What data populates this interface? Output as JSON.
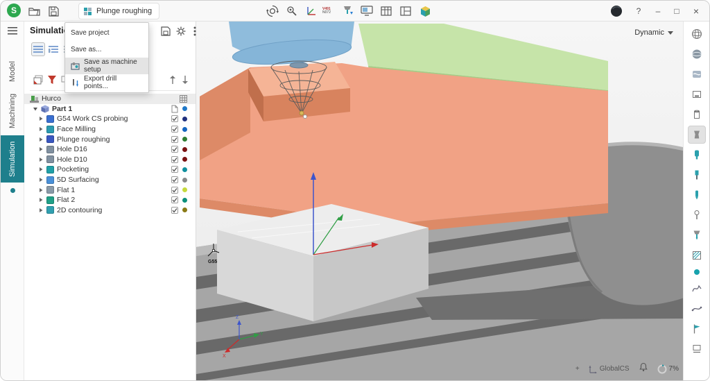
{
  "titlebar": {
    "logo_letter": "S",
    "operation_label": "Plunge roughing",
    "nc_line1": "V491",
    "nc_line2": "N072",
    "help_label": "?",
    "minimize_glyph": "–",
    "maximize_glyph": "□",
    "close_glyph": "×",
    "icons": [
      "app-logo",
      "open-project-icon",
      "save-project-icon",
      "operation-grid-icon",
      "simulation-settings-icon",
      "inspect-settings-icon",
      "machine-axes-icon",
      "nc-code-icon",
      "tool-change-icon",
      "monitor-icon",
      "table-icon",
      "panels-icon",
      "cube-icon",
      "account-icon"
    ]
  },
  "left_rail": {
    "accent": "#1e7f8c",
    "tabs": [
      {
        "label": "Model",
        "active": false
      },
      {
        "label": "Machining",
        "active": false
      },
      {
        "label": "Simulation",
        "active": true
      }
    ]
  },
  "panel": {
    "title": "Simulation",
    "toolbar_icons": [
      "list-view-icon",
      "indent-view-icon",
      "compact-view-icon",
      "filter-layers-icon",
      "filter-funnel-icon",
      "filter-ops-icon",
      "move-up-icon",
      "move-down-icon",
      "save-icon",
      "gear-icon",
      "kebab-icon"
    ]
  },
  "menu": {
    "items": [
      {
        "label": "Save project",
        "icon": null,
        "highlighted": false
      },
      {
        "label": "Save as...",
        "icon": null,
        "highlighted": false
      },
      {
        "label": "Save as machine setup",
        "icon": "machine-setup-icon",
        "highlighted": true
      },
      {
        "label": "Export drill points...",
        "icon": "export-drill-icon",
        "highlighted": false
      }
    ]
  },
  "tree": {
    "root": {
      "label": "Hurco"
    },
    "part": {
      "label": "Part 1",
      "color": "#1f78c8"
    },
    "operations": [
      {
        "label": "G54 Work CS probing",
        "color": "#20307e",
        "icon": "#3a6fd0",
        "checked": true
      },
      {
        "label": "Face Milling",
        "color": "#1565c0",
        "icon": "#2b9ab0",
        "checked": true
      },
      {
        "label": "Plunge roughing",
        "color": "#2e7d32",
        "icon": "#3a57c0",
        "checked": true
      },
      {
        "label": "Hole D16",
        "color": "#7b1212",
        "icon": "#8090a0",
        "checked": true
      },
      {
        "label": "Hole D10",
        "color": "#7b1212",
        "icon": "#8090a0",
        "checked": true
      },
      {
        "label": "Pocketing",
        "color": "#0f8f9e",
        "icon": "#20a0a8",
        "checked": true
      },
      {
        "label": "5D Surfacing",
        "color": "#8a8a8a",
        "icon": "#4a90d8",
        "checked": true
      },
      {
        "label": "Flat 1",
        "color": "#c6d93c",
        "icon": "#8a9aa8",
        "checked": true
      },
      {
        "label": "Flat 2",
        "color": "#0c8f7a",
        "icon": "#20a088",
        "checked": true
      },
      {
        "label": "2D contouring",
        "color": "#8a7a16",
        "icon": "#30a0b0",
        "checked": true
      }
    ]
  },
  "viewport": {
    "view_mode_label": "Dynamic",
    "origin_label": "G55",
    "axis_labels": {
      "x": "X",
      "y": "Y",
      "z": "Z"
    },
    "statusbar": {
      "plus_label": "+",
      "cs_label": "GlobalCS",
      "progress_label": "7%",
      "progress_percent": 7
    },
    "scene_colors": {
      "spindle": "#8fbcdc",
      "part": "#c6e4a9",
      "fixture": "#f1a285",
      "stock": "#ededed",
      "bed": "#a6a6a6"
    }
  },
  "right_toolbar": {
    "status_dot_color": "#17a2ad",
    "icons": [
      "wireframe-sphere-icon",
      "shaded-sphere-icon",
      "material-icon",
      "fixture-icon",
      "stock-icon",
      "holder-icon",
      "spindle-icon",
      "tool-icon",
      "tool-small-icon",
      "probe-icon",
      "tool-assembly-icon",
      "toolpath-hatch-icon",
      "toolpath-curve-icon",
      "toolpath-smooth-icon",
      "flag-icon",
      "banner-icon"
    ]
  }
}
